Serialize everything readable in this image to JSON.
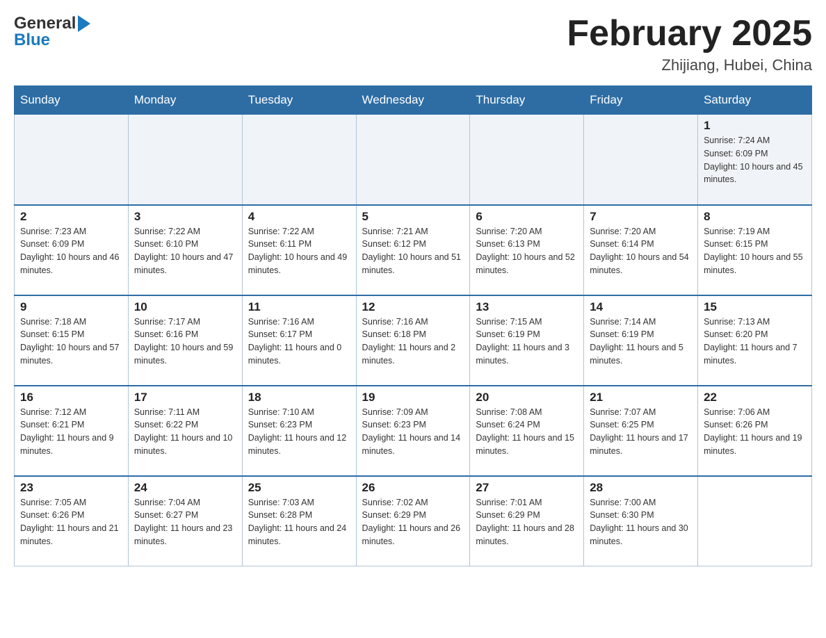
{
  "header": {
    "title": "February 2025",
    "subtitle": "Zhijiang, Hubei, China",
    "logo_general": "General",
    "logo_blue": "Blue"
  },
  "weekdays": [
    "Sunday",
    "Monday",
    "Tuesday",
    "Wednesday",
    "Thursday",
    "Friday",
    "Saturday"
  ],
  "weeks": [
    {
      "days": [
        {
          "num": "",
          "sunrise": "",
          "sunset": "",
          "daylight": ""
        },
        {
          "num": "",
          "sunrise": "",
          "sunset": "",
          "daylight": ""
        },
        {
          "num": "",
          "sunrise": "",
          "sunset": "",
          "daylight": ""
        },
        {
          "num": "",
          "sunrise": "",
          "sunset": "",
          "daylight": ""
        },
        {
          "num": "",
          "sunrise": "",
          "sunset": "",
          "daylight": ""
        },
        {
          "num": "",
          "sunrise": "",
          "sunset": "",
          "daylight": ""
        },
        {
          "num": "1",
          "sunrise": "Sunrise: 7:24 AM",
          "sunset": "Sunset: 6:09 PM",
          "daylight": "Daylight: 10 hours and 45 minutes."
        }
      ]
    },
    {
      "days": [
        {
          "num": "2",
          "sunrise": "Sunrise: 7:23 AM",
          "sunset": "Sunset: 6:09 PM",
          "daylight": "Daylight: 10 hours and 46 minutes."
        },
        {
          "num": "3",
          "sunrise": "Sunrise: 7:22 AM",
          "sunset": "Sunset: 6:10 PM",
          "daylight": "Daylight: 10 hours and 47 minutes."
        },
        {
          "num": "4",
          "sunrise": "Sunrise: 7:22 AM",
          "sunset": "Sunset: 6:11 PM",
          "daylight": "Daylight: 10 hours and 49 minutes."
        },
        {
          "num": "5",
          "sunrise": "Sunrise: 7:21 AM",
          "sunset": "Sunset: 6:12 PM",
          "daylight": "Daylight: 10 hours and 51 minutes."
        },
        {
          "num": "6",
          "sunrise": "Sunrise: 7:20 AM",
          "sunset": "Sunset: 6:13 PM",
          "daylight": "Daylight: 10 hours and 52 minutes."
        },
        {
          "num": "7",
          "sunrise": "Sunrise: 7:20 AM",
          "sunset": "Sunset: 6:14 PM",
          "daylight": "Daylight: 10 hours and 54 minutes."
        },
        {
          "num": "8",
          "sunrise": "Sunrise: 7:19 AM",
          "sunset": "Sunset: 6:15 PM",
          "daylight": "Daylight: 10 hours and 55 minutes."
        }
      ]
    },
    {
      "days": [
        {
          "num": "9",
          "sunrise": "Sunrise: 7:18 AM",
          "sunset": "Sunset: 6:15 PM",
          "daylight": "Daylight: 10 hours and 57 minutes."
        },
        {
          "num": "10",
          "sunrise": "Sunrise: 7:17 AM",
          "sunset": "Sunset: 6:16 PM",
          "daylight": "Daylight: 10 hours and 59 minutes."
        },
        {
          "num": "11",
          "sunrise": "Sunrise: 7:16 AM",
          "sunset": "Sunset: 6:17 PM",
          "daylight": "Daylight: 11 hours and 0 minutes."
        },
        {
          "num": "12",
          "sunrise": "Sunrise: 7:16 AM",
          "sunset": "Sunset: 6:18 PM",
          "daylight": "Daylight: 11 hours and 2 minutes."
        },
        {
          "num": "13",
          "sunrise": "Sunrise: 7:15 AM",
          "sunset": "Sunset: 6:19 PM",
          "daylight": "Daylight: 11 hours and 3 minutes."
        },
        {
          "num": "14",
          "sunrise": "Sunrise: 7:14 AM",
          "sunset": "Sunset: 6:19 PM",
          "daylight": "Daylight: 11 hours and 5 minutes."
        },
        {
          "num": "15",
          "sunrise": "Sunrise: 7:13 AM",
          "sunset": "Sunset: 6:20 PM",
          "daylight": "Daylight: 11 hours and 7 minutes."
        }
      ]
    },
    {
      "days": [
        {
          "num": "16",
          "sunrise": "Sunrise: 7:12 AM",
          "sunset": "Sunset: 6:21 PM",
          "daylight": "Daylight: 11 hours and 9 minutes."
        },
        {
          "num": "17",
          "sunrise": "Sunrise: 7:11 AM",
          "sunset": "Sunset: 6:22 PM",
          "daylight": "Daylight: 11 hours and 10 minutes."
        },
        {
          "num": "18",
          "sunrise": "Sunrise: 7:10 AM",
          "sunset": "Sunset: 6:23 PM",
          "daylight": "Daylight: 11 hours and 12 minutes."
        },
        {
          "num": "19",
          "sunrise": "Sunrise: 7:09 AM",
          "sunset": "Sunset: 6:23 PM",
          "daylight": "Daylight: 11 hours and 14 minutes."
        },
        {
          "num": "20",
          "sunrise": "Sunrise: 7:08 AM",
          "sunset": "Sunset: 6:24 PM",
          "daylight": "Daylight: 11 hours and 15 minutes."
        },
        {
          "num": "21",
          "sunrise": "Sunrise: 7:07 AM",
          "sunset": "Sunset: 6:25 PM",
          "daylight": "Daylight: 11 hours and 17 minutes."
        },
        {
          "num": "22",
          "sunrise": "Sunrise: 7:06 AM",
          "sunset": "Sunset: 6:26 PM",
          "daylight": "Daylight: 11 hours and 19 minutes."
        }
      ]
    },
    {
      "days": [
        {
          "num": "23",
          "sunrise": "Sunrise: 7:05 AM",
          "sunset": "Sunset: 6:26 PM",
          "daylight": "Daylight: 11 hours and 21 minutes."
        },
        {
          "num": "24",
          "sunrise": "Sunrise: 7:04 AM",
          "sunset": "Sunset: 6:27 PM",
          "daylight": "Daylight: 11 hours and 23 minutes."
        },
        {
          "num": "25",
          "sunrise": "Sunrise: 7:03 AM",
          "sunset": "Sunset: 6:28 PM",
          "daylight": "Daylight: 11 hours and 24 minutes."
        },
        {
          "num": "26",
          "sunrise": "Sunrise: 7:02 AM",
          "sunset": "Sunset: 6:29 PM",
          "daylight": "Daylight: 11 hours and 26 minutes."
        },
        {
          "num": "27",
          "sunrise": "Sunrise: 7:01 AM",
          "sunset": "Sunset: 6:29 PM",
          "daylight": "Daylight: 11 hours and 28 minutes."
        },
        {
          "num": "28",
          "sunrise": "Sunrise: 7:00 AM",
          "sunset": "Sunset: 6:30 PM",
          "daylight": "Daylight: 11 hours and 30 minutes."
        },
        {
          "num": "",
          "sunrise": "",
          "sunset": "",
          "daylight": ""
        }
      ]
    }
  ]
}
